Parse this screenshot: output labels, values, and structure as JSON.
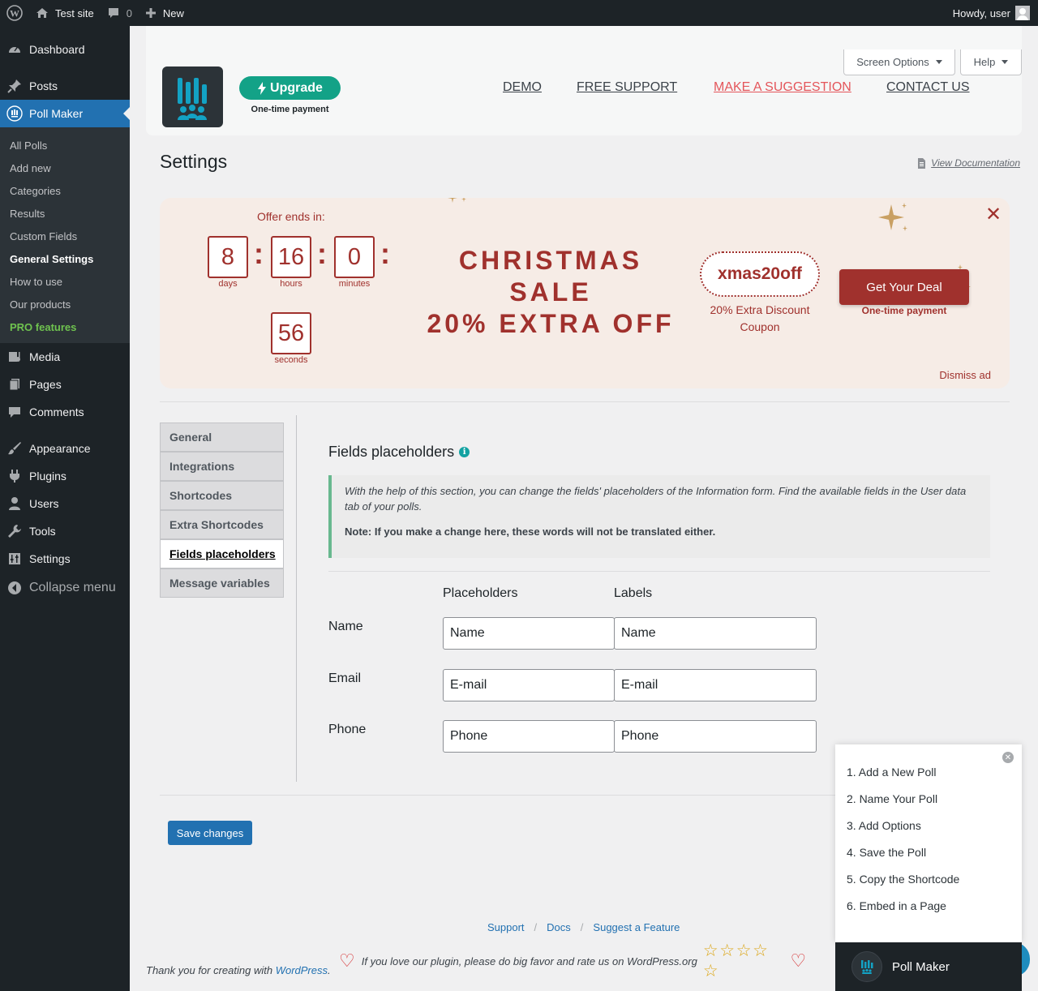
{
  "adminbar": {
    "site_name": "Test site",
    "comments_count": "0",
    "new_label": "New",
    "howdy": "Howdy, user"
  },
  "sidebar": {
    "items_top": [
      {
        "label": "Dashboard",
        "icon": "dashboard-icon"
      }
    ],
    "posts": "Posts",
    "poll_maker": "Poll Maker",
    "submenu": [
      "All Polls",
      "Add new",
      "Categories",
      "Results",
      "Custom Fields",
      "General Settings",
      "How to use",
      "Our products",
      "PRO features"
    ],
    "items_bottom": [
      "Media",
      "Pages",
      "Comments",
      "Appearance",
      "Plugins",
      "Users",
      "Tools",
      "Settings"
    ],
    "collapse": "Collapse menu"
  },
  "header": {
    "screen_options": "Screen Options",
    "help": "Help",
    "upgrade": "Upgrade",
    "one_time": "One-time payment",
    "links": {
      "demo": "DEMO",
      "support": "FREE SUPPORT",
      "suggest": "MAKE A SUGGESTION",
      "contact": "CONTACT US"
    }
  },
  "page": {
    "title": "Settings",
    "view_doc": "View Documentation"
  },
  "banner": {
    "offer_ends": "Offer ends in:",
    "days": "8",
    "days_label": "days",
    "hours": "16",
    "hours_label": "hours",
    "minutes": "0",
    "minutes_label": "minutes",
    "seconds": "56",
    "seconds_label": "seconds",
    "colon": ":",
    "sale_line1": "CHRISTMAS",
    "sale_line2": "SALE",
    "sale_line3": "20% EXTRA OFF",
    "coupon": "xmas20off",
    "coupon_text": "20% Extra Discount Coupon",
    "deal": "Get Your Deal",
    "deal_sub": "One-time payment",
    "close": "✕",
    "dismiss": "Dismiss ad",
    "accent_color": "#a0312d"
  },
  "tabs": [
    "General",
    "Integrations",
    "Shortcodes",
    "Extra Shortcodes",
    "Fields placeholders",
    "Message variables"
  ],
  "section": {
    "title": "Fields placeholders",
    "notice_italic": "With the help of this section, you can change the fields' placeholders of the Information form. Find the available fields in the User data tab of your polls.",
    "notice_bold": "Note: If you make a change here, these words will not be translated either.",
    "col_placeholders": "Placeholders",
    "col_labels": "Labels",
    "rows": [
      {
        "label": "Name",
        "placeholder": "Name",
        "field_label": "Name"
      },
      {
        "label": "Email",
        "placeholder": "E-mail",
        "field_label": "E-mail"
      },
      {
        "label": "Phone",
        "placeholder": "Phone",
        "field_label": "Phone"
      }
    ]
  },
  "save_label": "Save changes",
  "footer": {
    "support": "Support",
    "docs": "Docs",
    "suggest": "Suggest a Feature",
    "slash": "/",
    "rate_text": "If you love our plugin, please do big favor and rate us on WordPress.org",
    "thanks_prefix": "Thank you for creating with",
    "thanks_link": "WordPress",
    "thanks_suffix": "."
  },
  "guide": {
    "steps": [
      "1. Add a New Poll",
      "2. Name Your Poll",
      "3. Add Options",
      "4. Save the Poll",
      "5. Copy the Shortcode",
      "6. Embed in a Page"
    ],
    "bar_title": "Poll Maker"
  }
}
